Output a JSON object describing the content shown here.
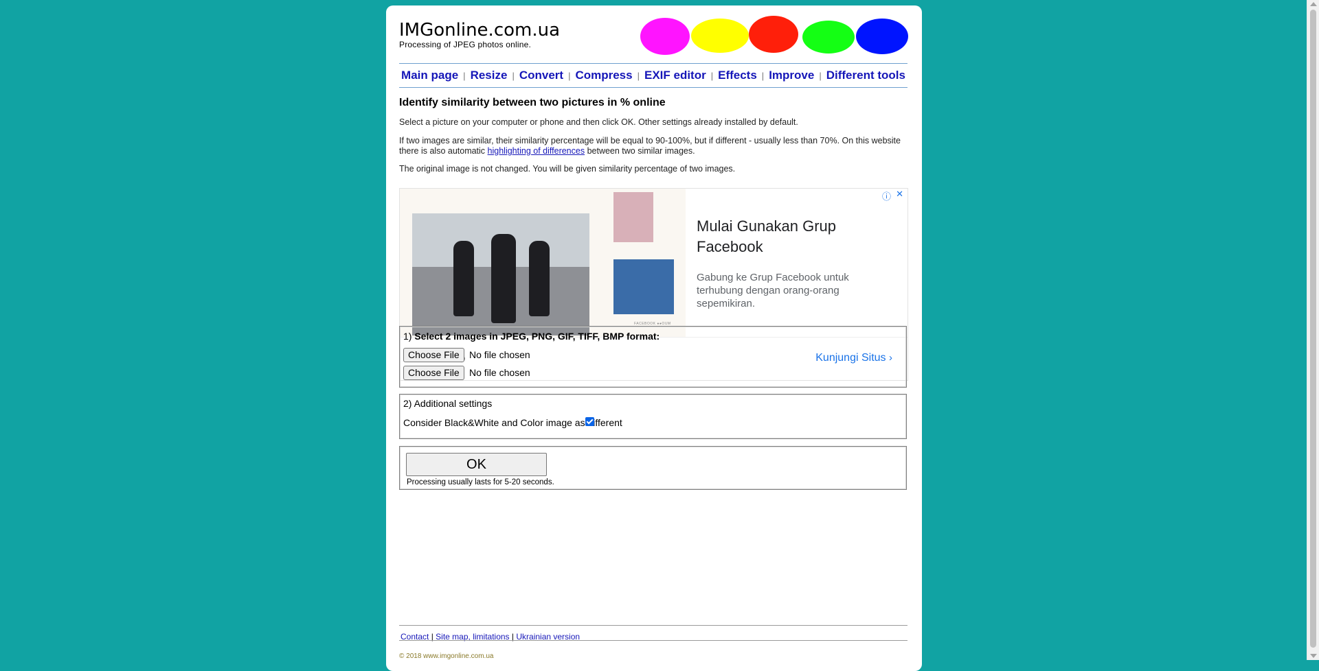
{
  "site": {
    "title": "IMGonline.com.ua",
    "subtitle": "Processing of JPEG photos online.",
    "blob_colors": [
      "#ff14ff",
      "#ffff00",
      "#ff1f0a",
      "#14ff14",
      "#0014ff"
    ]
  },
  "nav": {
    "items": [
      "Main page",
      "Resize",
      "Convert",
      "Compress",
      "EXIF editor",
      "Effects",
      "Improve",
      "Different tools"
    ],
    "separator": "|",
    "link_color": "#1516b8"
  },
  "main": {
    "heading": "Identify similarity between two pictures in % online",
    "p1": "Select a picture on your computer or phone and then click OK. Other settings already installed by default.",
    "p2_before": "If two images are similar, their similarity percentage will be equal to 90-100%, but if different - usually less than 70%. On this website there is also automatic ",
    "p2_link": "highlighting of differences",
    "p2_after": " between two similar images.",
    "p3": "The original image is not changed. You will be given similarity percentage of two images."
  },
  "ad": {
    "title": "Mulai Gunakan Grup Facebook",
    "description": "Gabung ke Grup Facebook untuk terhubung dengan orang-orang sepemikiran.",
    "brand": "Facebook®",
    "cta": "Kunjungi Situs",
    "cta_icon": "chevron-right-icon",
    "photo_caption": "FACEBOOK ●●OUM",
    "info_icon": "ⓘ",
    "close_icon": "✕"
  },
  "section1": {
    "prefix": "1) ",
    "label": "Select 2 images in JPEG, PNG, GIF, TIFF, BMP format:",
    "file_inputs": [
      {
        "button": "Choose File",
        "status": "No file chosen"
      },
      {
        "button": "Choose File",
        "status": "No file chosen"
      }
    ]
  },
  "section2": {
    "label": "2) Additional settings",
    "option_label": "Consider Black&White and Color image as different",
    "option_checked": true
  },
  "section3": {
    "ok_label": "OK",
    "note": "Processing usually lasts for 5-20 seconds."
  },
  "footer": {
    "links": [
      "Contact",
      "Site map, limitations",
      "Ukrainian version"
    ],
    "separator": "|",
    "copyright": "© 2018 www.imgonline.com.ua"
  }
}
